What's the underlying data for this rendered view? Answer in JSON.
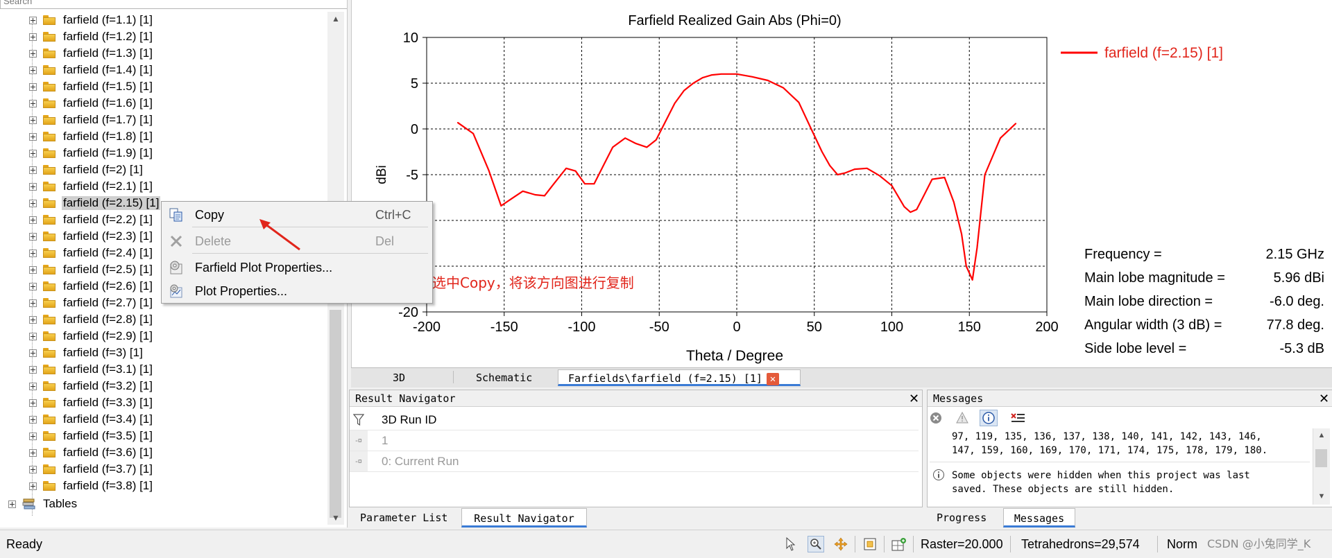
{
  "tree": {
    "search_placeholder": "Search",
    "items": [
      {
        "label": "farfield (f=1.1) [1]"
      },
      {
        "label": "farfield (f=1.2) [1]"
      },
      {
        "label": "farfield (f=1.3) [1]"
      },
      {
        "label": "farfield (f=1.4) [1]"
      },
      {
        "label": "farfield (f=1.5) [1]"
      },
      {
        "label": "farfield (f=1.6) [1]"
      },
      {
        "label": "farfield (f=1.7) [1]"
      },
      {
        "label": "farfield (f=1.8) [1]"
      },
      {
        "label": "farfield (f=1.9) [1]"
      },
      {
        "label": "farfield (f=2) [1]"
      },
      {
        "label": "farfield (f=2.1) [1]"
      },
      {
        "label": "farfield (f=2.15) [1]"
      },
      {
        "label": "farfield (f=2.2) [1]"
      },
      {
        "label": "farfield (f=2.3) [1]"
      },
      {
        "label": "farfield (f=2.4) [1]"
      },
      {
        "label": "farfield (f=2.5) [1]"
      },
      {
        "label": "farfield (f=2.6) [1]"
      },
      {
        "label": "farfield (f=2.7) [1]"
      },
      {
        "label": "farfield (f=2.8) [1]"
      },
      {
        "label": "farfield (f=2.9) [1]"
      },
      {
        "label": "farfield (f=3) [1]"
      },
      {
        "label": "farfield (f=3.1) [1]"
      },
      {
        "label": "farfield (f=3.2) [1]"
      },
      {
        "label": "farfield (f=3.3) [1]"
      },
      {
        "label": "farfield (f=3.4) [1]"
      },
      {
        "label": "farfield (f=3.5) [1]"
      },
      {
        "label": "farfield (f=3.6) [1]"
      },
      {
        "label": "farfield (f=3.7) [1]"
      },
      {
        "label": "farfield (f=3.8) [1]"
      }
    ],
    "selected_index": 11,
    "tables_label": "Tables"
  },
  "context_menu": {
    "items": [
      {
        "label": "Copy",
        "shortcut": "Ctrl+C",
        "enabled": true,
        "icon": "copy-icon"
      },
      {
        "label": "Delete",
        "shortcut": "Del",
        "enabled": false,
        "icon": "delete-icon"
      },
      {
        "label": "Farfield Plot Properties...",
        "shortcut": "",
        "enabled": true,
        "icon": "farfield-properties-icon"
      },
      {
        "label": "Plot Properties...",
        "shortcut": "",
        "enabled": true,
        "icon": "plot-properties-icon"
      }
    ]
  },
  "annotation": {
    "text": "鼠标右键，选中Copy，将该方向图进行复制",
    "color": "#e1251b"
  },
  "chart_data": {
    "type": "line",
    "title": "Farfield Realized Gain Abs (Phi=0)",
    "xlabel": "Theta / Degree",
    "ylabel": "dBi",
    "xlim": [
      -200,
      200
    ],
    "ylim": [
      -20,
      10
    ],
    "xticks": [
      -200,
      -150,
      -100,
      -50,
      0,
      50,
      100,
      150,
      200
    ],
    "yticks": [
      10,
      5,
      0,
      -5,
      -10,
      -15,
      -20
    ],
    "ytick_labels": [
      "10",
      "5",
      "0",
      "-5",
      "",
      "",
      "-20"
    ],
    "grid": true,
    "legend_position": "top-right, outside plot",
    "series": [
      {
        "name": "farfield (f=2.15) [1]",
        "color": "#ff0000",
        "x": [
          -180,
          -170,
          -160,
          -152,
          -145,
          -138,
          -130,
          -124,
          -118,
          -110,
          -104,
          -98,
          -92,
          -86,
          -80,
          -72,
          -65,
          -58,
          -52,
          -46,
          -40,
          -34,
          -28,
          -22,
          -16,
          -10,
          -6,
          0,
          10,
          20,
          30,
          40,
          48,
          55,
          60,
          65,
          70,
          76,
          84,
          92,
          100,
          108,
          112,
          116,
          120,
          126,
          134,
          140,
          145,
          148,
          152,
          155,
          160,
          170,
          180
        ],
        "values": [
          0.7,
          -0.5,
          -4.5,
          -8.4,
          -7.6,
          -6.8,
          -7.2,
          -7.3,
          -6.0,
          -4.3,
          -4.6,
          -6.0,
          -6.0,
          -4.0,
          -2.0,
          -1.0,
          -1.6,
          -2.0,
          -1.2,
          0.8,
          2.8,
          4.2,
          5.0,
          5.6,
          5.9,
          6.0,
          6.0,
          6.0,
          5.7,
          5.3,
          4.5,
          2.9,
          0.0,
          -2.5,
          -4.0,
          -5.0,
          -4.8,
          -4.4,
          -4.3,
          -5.1,
          -6.2,
          -8.5,
          -9.1,
          -8.8,
          -7.5,
          -5.5,
          -5.3,
          -8.0,
          -11.5,
          -15.0,
          -16.5,
          -13.0,
          -5.0,
          -1.0,
          0.6
        ]
      }
    ],
    "info": [
      {
        "label": "Frequency =",
        "value": "2.15 GHz"
      },
      {
        "label": "Main lobe magnitude =",
        "value": "5.96 dBi"
      },
      {
        "label": "Main lobe direction =",
        "value": "-6.0 deg."
      },
      {
        "label": "Angular width (3 dB) =",
        "value": "77.8 deg."
      },
      {
        "label": "Side lobe level =",
        "value": "-5.3 dB"
      }
    ]
  },
  "plot_tabs": {
    "tabs": [
      "3D",
      "Schematic",
      "Farfields\\farfield (f=2.15) [1]"
    ],
    "active_index": 2
  },
  "result_navigator": {
    "title": "Result Navigator",
    "header": "3D Run ID",
    "rows": [
      "1",
      "0: Current Run"
    ]
  },
  "bottom_left_tabs": {
    "tabs": [
      "Parameter List",
      "Result Navigator"
    ],
    "active_index": 1
  },
  "messages": {
    "title": "Messages",
    "line1": "97, 119, 135, 136, 137, 138, 140, 141, 142, 143, 146,",
    "line2": "147, 159, 160, 169, 170, 171, 174, 175, 178, 179, 180.",
    "info_line1": "Some objects were hidden when this project was last",
    "info_line2": "saved. These objects are still hidden."
  },
  "bottom_right_tabs": {
    "tabs": [
      "Progress",
      "Messages"
    ],
    "active_index": 1
  },
  "status_bar": {
    "status": "Ready",
    "raster": "Raster=20.000",
    "tetrahedrons": "Tetrahedrons=29,574",
    "mode": "Norm",
    "watermark": "CSDN @小兔同学_K"
  }
}
